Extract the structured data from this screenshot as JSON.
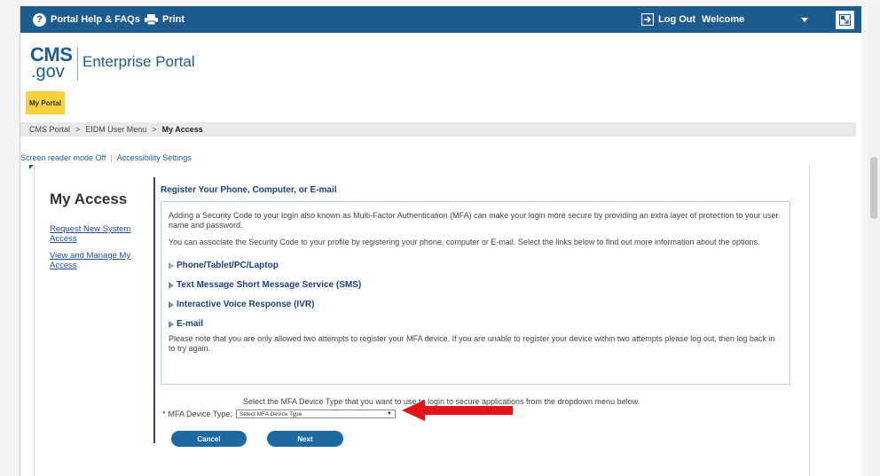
{
  "topbar": {
    "help_label": "Portal Help & FAQs",
    "print_label": "Print",
    "logout_label": "Log Out",
    "welcome_label": "Welcome",
    "bg_color": "#1e5b8e"
  },
  "header": {
    "logo_cms": "CMS",
    "logo_gov": ".gov",
    "portal_title": "Enterprise Portal"
  },
  "nav": {
    "my_portal_tab": "My Portal"
  },
  "breadcrumb": [
    "CMS Portal",
    "EIDM User Menu",
    "My Access"
  ],
  "breadcrumb_separator": ">",
  "accessibility": {
    "screen_reader": "Screen reader mode Off",
    "divider": "|",
    "settings": "Accessibility Settings"
  },
  "sidebar": {
    "title": "My Access",
    "links": [
      "Request New System Access",
      "View and Manage My Access"
    ]
  },
  "main": {
    "title": "Register Your Phone, Computer, or E-mail",
    "para1": "Adding a Security Code to your login also known as Multi-Factor Authentication (MFA) can make your login more secure by providing an extra layer of protection to your user name and password.",
    "para2": "You can associate the Security Code to your profile by registering your phone, computer or E-mail. Select the links below to find out more information about the options.",
    "options": [
      "Phone/Tablet/PC/Laptop",
      "Text Message Short Message Service (SMS)",
      "Interactive Voice Response (IVR)",
      "E-mail"
    ],
    "note": "Please note that you are only allowed two attempts to register your MFA device. If you are unable to register your device within two attempts please log out, then log back in to try again.",
    "select_instruction": "Select the MFA Device Type that you want to use to login to secure applications from the dropdown menu below.",
    "required_mark": "*",
    "mfa_label": "MFA Device Type:",
    "mfa_select_value": "Select MFA Device Type",
    "cancel_label": "Cancel",
    "next_label": "Next"
  },
  "colors": {
    "accent": "#1e5b8e",
    "tab_yellow": "#f6d13d",
    "button": "#1d6aa3",
    "arrow": "#e0141a"
  }
}
